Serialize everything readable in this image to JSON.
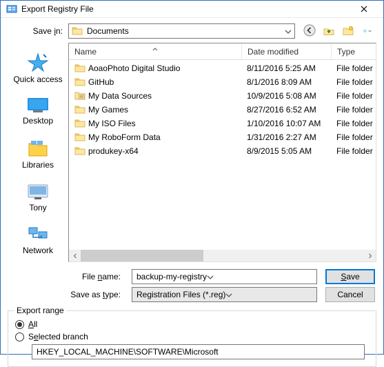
{
  "window": {
    "title": "Export Registry File"
  },
  "savein": {
    "label_html": "Save in:",
    "value": "Documents"
  },
  "places": [
    {
      "label": "Quick access"
    },
    {
      "label": "Desktop"
    },
    {
      "label": "Libraries"
    },
    {
      "label": "Tony"
    },
    {
      "label": "Network"
    }
  ],
  "columns": {
    "name": "Name",
    "date": "Date modified",
    "type": "Type"
  },
  "files": [
    {
      "name": "AoaoPhoto Digital Studio",
      "date": "8/11/2016 5:25 AM",
      "type": "File folder",
      "special": false
    },
    {
      "name": "GitHub",
      "date": "8/1/2016 8:09 AM",
      "type": "File folder",
      "special": false
    },
    {
      "name": "My Data Sources",
      "date": "10/9/2016 5:08 AM",
      "type": "File folder",
      "special": true
    },
    {
      "name": "My Games",
      "date": "8/27/2016 6:52 AM",
      "type": "File folder",
      "special": false
    },
    {
      "name": "My ISO Files",
      "date": "1/10/2016 10:07 AM",
      "type": "File folder",
      "special": false
    },
    {
      "name": "My RoboForm Data",
      "date": "1/31/2016 2:27 AM",
      "type": "File folder",
      "special": false
    },
    {
      "name": "produkey-x64",
      "date": "8/9/2015 5:05 AM",
      "type": "File folder",
      "special": false
    }
  ],
  "filename": {
    "label": "File name:",
    "value": "backup-my-registry"
  },
  "savetype": {
    "label": "Save as type:",
    "value": "Registration Files (*.reg)"
  },
  "buttons": {
    "save": "Save",
    "cancel": "Cancel"
  },
  "export": {
    "legend": "Export range",
    "all": "All",
    "selected": "Selected branch",
    "branch": "HKEY_LOCAL_MACHINE\\SOFTWARE\\Microsoft"
  }
}
